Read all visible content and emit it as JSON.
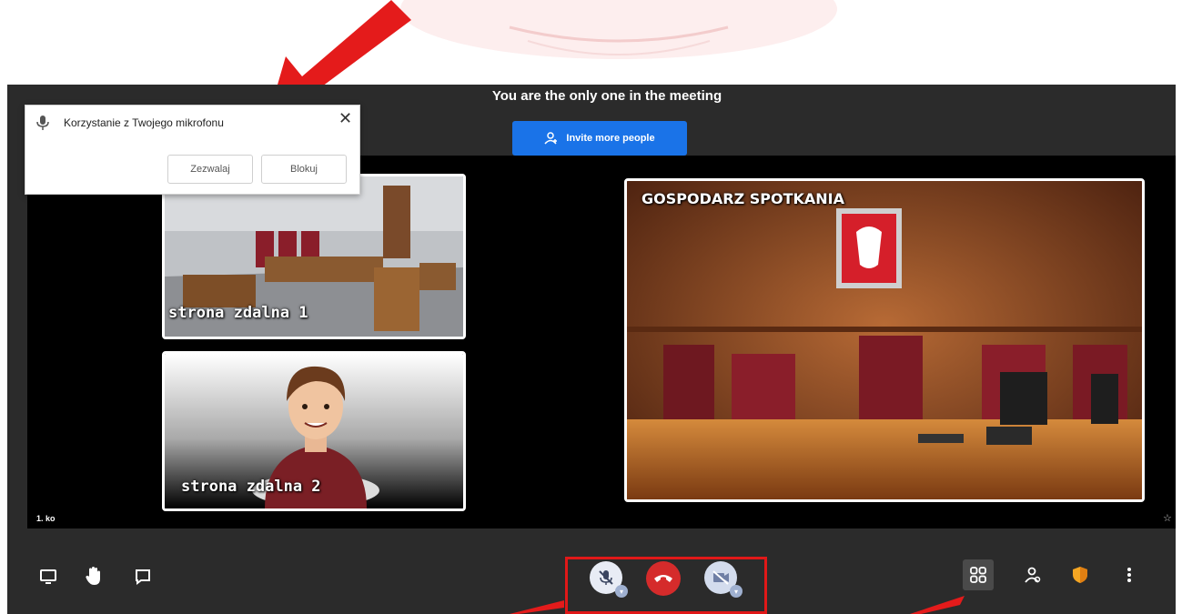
{
  "meeting": {
    "status_text": "You are the only one in the meeting",
    "invite_label": "Invite more people",
    "corner_left_text": "1. ko",
    "corner_right_icon": "star-icon"
  },
  "popup": {
    "message": "Korzystanie z Twojego mikrofonu",
    "allow_label": "Zezwalaj",
    "block_label": "Blokuj",
    "icon": "microphone-icon"
  },
  "tiles": {
    "remote1_label": "strona zdalna 1",
    "remote2_label": "strona zdalna 2",
    "host_label": "GOSPODARZ SPOTKANIA"
  },
  "toolbar": {
    "left": [
      "screen-share-icon",
      "raise-hand-icon",
      "chat-icon"
    ],
    "center": [
      "mute-mic-icon",
      "hang-up-icon",
      "camera-off-icon"
    ],
    "right": [
      "tile-view-icon",
      "invite-icon",
      "security-shield-icon",
      "more-options-icon"
    ]
  },
  "colors": {
    "accent": "#1a73e8",
    "hangup": "#d52b2b",
    "annotation": "#e01818",
    "shield": "#f5a623"
  }
}
